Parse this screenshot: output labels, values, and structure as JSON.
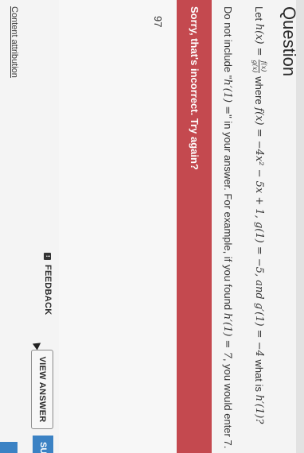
{
  "question": {
    "heading": "Question",
    "line1": {
      "let": "Let",
      "h_lhs": "h(x) =",
      "frac_num": "f(x)",
      "frac_den": "g(x)",
      "where": "where",
      "f_def": "f(x) = −4x² − 5x + 1, g(1) = −5, and g′(1) = −4",
      "what_is": "what is",
      "h_prime": "h′(1)?"
    },
    "line2": {
      "part1": "Do not include \"",
      "m1": "h′(1) =",
      "part2": "\" in your answer. For example, if you found ",
      "m2": "h′(1) = 7",
      "part3": ", you would enter 7."
    }
  },
  "feedback": {
    "error_message": "Sorry, that's incorrect. Try again?"
  },
  "answer": {
    "value": "97"
  },
  "buttons": {
    "feedback_label": "FEEDBACK",
    "view_answer_label": "VIEW ANSWER",
    "submit_label": "SU"
  },
  "footer": {
    "content_attribution": "Content attribution"
  },
  "colors": {
    "error_banner": "#c4494f",
    "submit_button": "#3b82c4"
  }
}
